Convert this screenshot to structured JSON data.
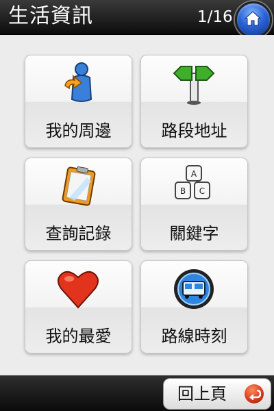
{
  "header": {
    "title": "生活資訊",
    "page_indicator": "1/16",
    "home_icon": "home-icon"
  },
  "menu": {
    "items": [
      {
        "label": "我的周邊",
        "icon": "person-nearby-icon"
      },
      {
        "label": "路段地址",
        "icon": "signpost-icon"
      },
      {
        "label": "查詢記錄",
        "icon": "clipboard-icon"
      },
      {
        "label": "關鍵字",
        "icon": "keyboard-keys-icon"
      },
      {
        "label": "我的最愛",
        "icon": "heart-icon"
      },
      {
        "label": "路線時刻",
        "icon": "bus-icon"
      }
    ],
    "keys": [
      "A",
      "B",
      "C"
    ]
  },
  "footer": {
    "back_label": "回上頁",
    "back_icon": "back-arrow-icon"
  },
  "colors": {
    "header_bg": "#1a1a1a",
    "home_blue": "#2a63d6",
    "back_red": "#d2381a"
  }
}
